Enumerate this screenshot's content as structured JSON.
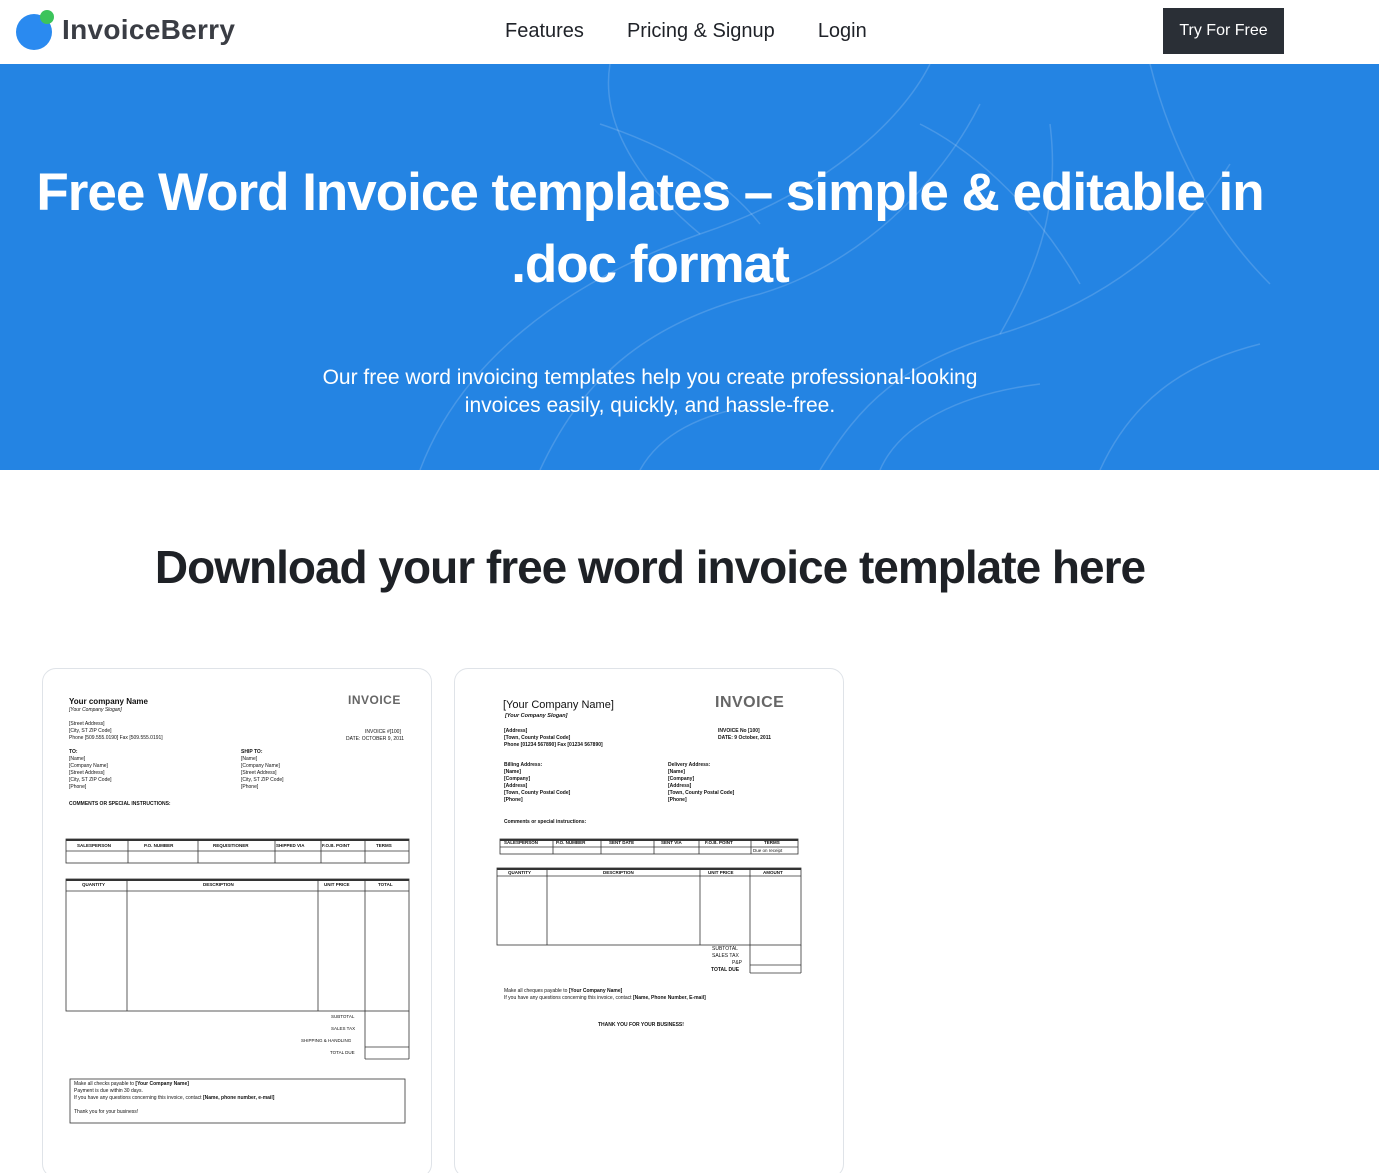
{
  "brand": {
    "name": "InvoiceBerry"
  },
  "nav": {
    "items": [
      "Features",
      "Pricing & Signup",
      "Login"
    ],
    "cta": "Try For Free"
  },
  "hero": {
    "title_line1": "Free Word Invoice templates – simple & editable in",
    "title_line2": ".doc format",
    "subtitle_line1": "Our free word invoicing templates help you create professional-looking",
    "subtitle_line2": "invoices easily, quickly, and hassle-free."
  },
  "section": {
    "title": "Download your free word invoice template here"
  },
  "template1": {
    "company": "Your company Name",
    "slogan": "[Your Company Slogan]",
    "heading": "INVOICE",
    "address": [
      "[Street Address]",
      "[City, ST  ZIP Code]",
      "Phone [509.555.0190]  Fax [509.555.0191]"
    ],
    "invoice_no": "INVOICE #[100]",
    "date": "DATE: OCTOBER 9, 2011",
    "to_label": "TO:",
    "to_lines": [
      "[Name]",
      "[Company Name]",
      "[Street Address]",
      "[City, ST  ZIP Code]",
      "[Phone]"
    ],
    "ship_label": "SHIP TO:",
    "ship_lines": [
      "[Name]",
      "[Company Name]",
      "[Street Address]",
      "[City, ST  ZIP Code]",
      "[Phone]"
    ],
    "comments": "COMMENTS OR SPECIAL INSTRUCTIONS:",
    "order_cols": [
      "SALESPERSON",
      "P.O. NUMBER",
      "REQUISITIONER",
      "SHIPPED VIA",
      "F.O.B. POINT",
      "TERMS"
    ],
    "item_cols": [
      "QUANTITY",
      "DESCRIPTION",
      "UNIT PRICE",
      "TOTAL"
    ],
    "totals": [
      "SUBTOTAL",
      "SALES TAX",
      "SHIPPING & HANDLING",
      "TOTAL DUE"
    ],
    "note_line1_a": "Make all checks payable to ",
    "note_line1_b": "[Your Company Name]",
    "note_line2": "Payment is due within 30 days.",
    "note_line3_a": "If you have any questions concerning this invoice, contact ",
    "note_line3_b": "[Name, phone number, e-mail]",
    "note_thanks": "Thank you for your business!"
  },
  "template2": {
    "company": "[Your Company Name]",
    "slogan": "[Your Company Slogan]",
    "heading": "INVOICE",
    "address": [
      "[Address]",
      "[Town, County  Postal Code]",
      "Phone [01234 567890] Fax [01234 567890]"
    ],
    "invoice_no": "INVOICE No [100]",
    "date": "DATE:  9 October, 2011",
    "billing_label": "Billing Address:",
    "billing_lines": [
      "[Name]",
      "[Company]",
      "[Address]",
      "[Town, County  Postal Code]",
      "[Phone]"
    ],
    "delivery_label": "Delivery Address:",
    "delivery_lines": [
      "[Name]",
      "[Company]",
      "[Address]",
      "[Town, County  Postal Code]",
      "[Phone]"
    ],
    "comments": "Comments or special instructions:",
    "order_cols": [
      "SALESPERSON",
      "P.O. NUMBER",
      "SENT DATE",
      "SENT VIA",
      "F.O.B. POINT",
      "TERMS"
    ],
    "terms_value": "Due on receipt",
    "item_cols": [
      "QUANTITY",
      "DESCRIPTION",
      "UNIT PRICE",
      "AMOUNT"
    ],
    "totals": [
      "SUBTOTAL",
      "SALES TAX",
      "P&P",
      "TOTAL DUE"
    ],
    "note_line1_a": "Make all cheques payable to ",
    "note_line1_b": "[Your Company Name]",
    "note_line2_a": "If you have any questions concerning this invoice, contact ",
    "note_line2_b": "[Name, Phone Number, E-mail]",
    "thanks": "THANK YOU FOR YOUR BUSINESS!"
  }
}
